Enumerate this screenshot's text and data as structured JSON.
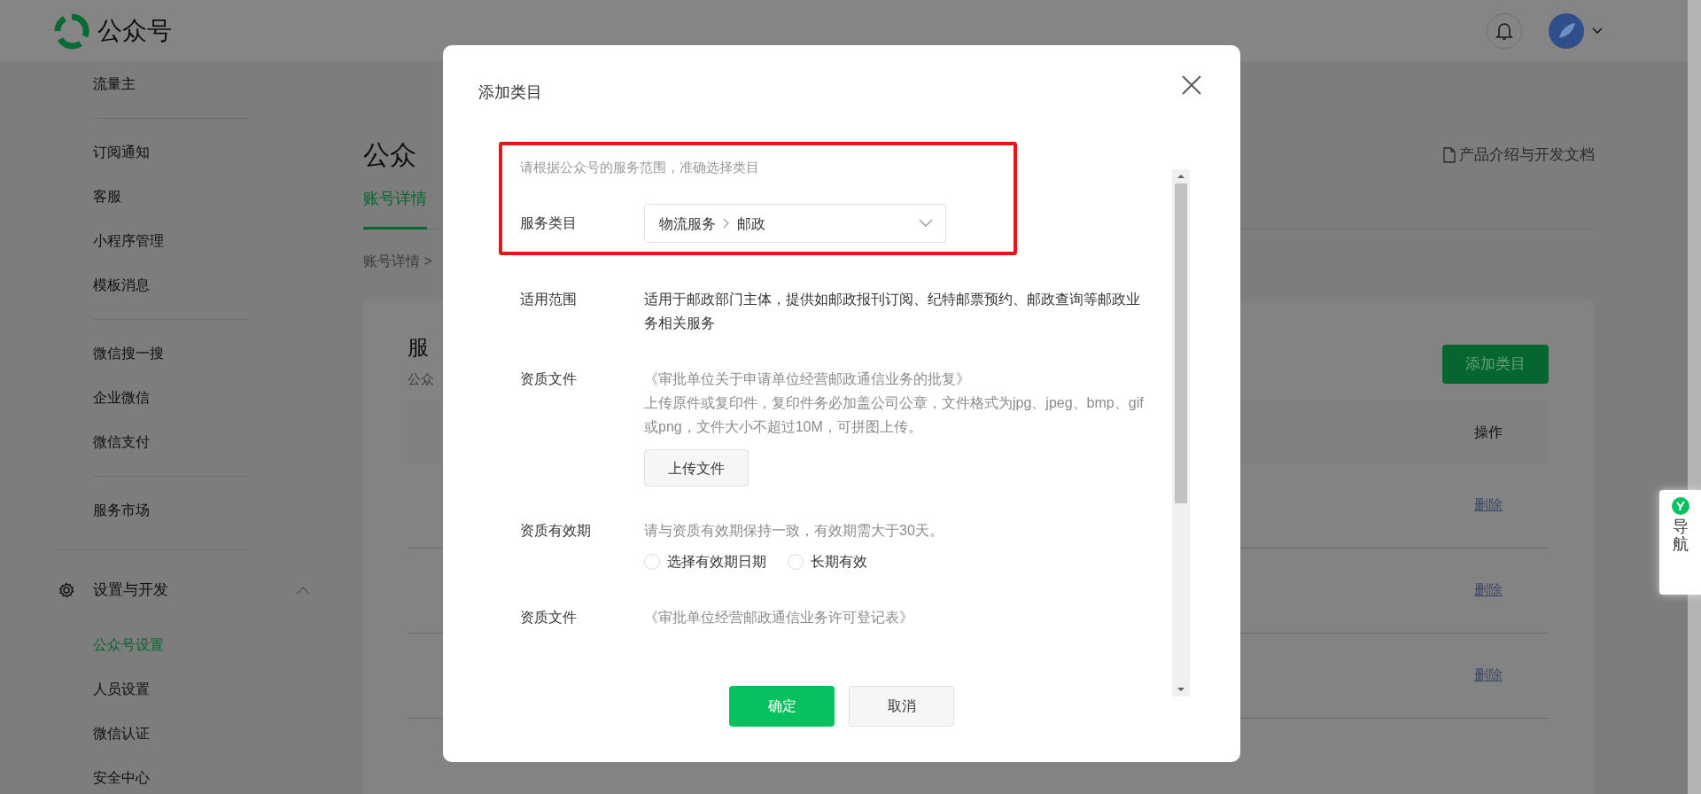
{
  "header": {
    "logo_text": "公众号"
  },
  "sidebar": {
    "groups": [
      {
        "items": [
          {
            "label": "流量主",
            "selected": false
          }
        ]
      },
      {
        "items": [
          {
            "label": "订阅通知",
            "selected": false
          },
          {
            "label": "客服",
            "selected": false
          },
          {
            "label": "小程序管理",
            "selected": false
          },
          {
            "label": "模板消息",
            "selected": false
          }
        ]
      },
      {
        "items": [
          {
            "label": "微信搜一搜",
            "selected": false
          },
          {
            "label": "企业微信",
            "selected": false
          },
          {
            "label": "微信支付",
            "selected": false
          }
        ]
      },
      {
        "items": [
          {
            "label": "服务市场",
            "selected": false
          }
        ]
      }
    ],
    "section": {
      "label": "设置与开发",
      "expanded": true,
      "items": [
        {
          "label": "公众号设置",
          "selected": true
        },
        {
          "label": "人员设置",
          "selected": false
        },
        {
          "label": "微信认证",
          "selected": false
        },
        {
          "label": "安全中心",
          "selected": false
        }
      ]
    }
  },
  "main": {
    "title": "公众",
    "docs_link": "产品介绍与开发文档",
    "tabs": [
      {
        "label": "账号详情",
        "selected": true
      }
    ],
    "breadcrumb": "账号详情 >",
    "card": {
      "title": "服",
      "subtitle": "公众",
      "add_button": "添加类目",
      "table": {
        "action_header": "操作",
        "rows": [
          {
            "action": "删除"
          },
          {
            "action": "删除"
          },
          {
            "action": "删除"
          }
        ]
      }
    }
  },
  "nav_float": {
    "label": "导航"
  },
  "dialog": {
    "title": "添加类目",
    "highlighted_group": {
      "intro": "请根据公众号的服务范围，准确选择类目",
      "fields": [
        {
          "kind": "select",
          "label": "服务类目",
          "path": [
            "物流服务",
            "邮政"
          ]
        }
      ]
    },
    "fields": [
      {
        "kind": "text",
        "label": "适用范围",
        "text": "适用于邮政部门主体，提供如邮政报刊订阅、纪特邮票预约、邮政查询等邮政业务相关服务"
      },
      {
        "kind": "file",
        "label": "资质文件",
        "doc": "《审批单位关于申请单位经营邮政通信业务的批复》",
        "note": "上传原件或复印件，复印件务必加盖公司公章，文件格式为jpg、jpeg、bmp、gif或png，文件大小不超过10M，可拼图上传。",
        "button": "上传文件"
      },
      {
        "kind": "radio",
        "label": "资质有效期",
        "note": "请与资质有效期保持一致，有效期需大于30天。",
        "options": [
          {
            "label": "选择有效期日期",
            "selected": false
          },
          {
            "label": "长期有效",
            "selected": false
          }
        ]
      },
      {
        "kind": "file",
        "label": "资质文件",
        "doc": "《审批单位经营邮政通信业务许可登记表》"
      }
    ],
    "buttons": [
      {
        "label": "确定",
        "kind": "primary"
      },
      {
        "label": "取消",
        "kind": "default"
      }
    ]
  }
}
